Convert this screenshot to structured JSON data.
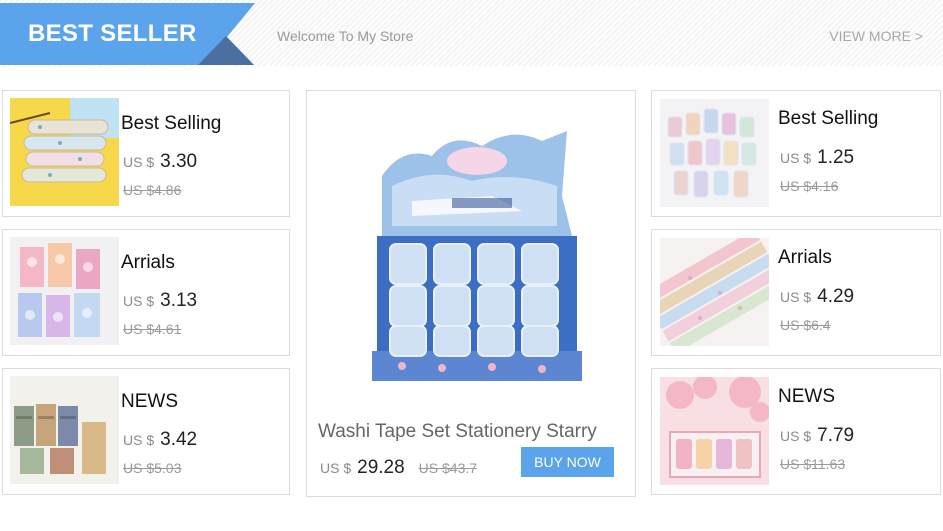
{
  "banner": {
    "title": "BEST SELLER",
    "welcome": "Welcome To My Store",
    "view_more": "VIEW MORE >",
    "accent_color": "#5ba3ea"
  },
  "left_cards": [
    {
      "name": "Best Selling",
      "currency": "US $",
      "price": "3.30",
      "old_price": "US $4.86",
      "image": "washi-tape-rolls-yellow-image"
    },
    {
      "name": "Arrials",
      "currency": "US $",
      "price": "3.13",
      "old_price": "US $4.61",
      "image": "washi-tape-sets-pink-image"
    },
    {
      "name": "NEWS",
      "currency": "US $",
      "price": "3.42",
      "old_price": "US $5.03",
      "image": "washi-tape-stack-image"
    }
  ],
  "right_cards": [
    {
      "name": "Best Selling",
      "currency": "US $",
      "price": "1.25",
      "old_price": "US $4.16",
      "image": "washi-tape-grid-image"
    },
    {
      "name": "Arrials",
      "currency": "US $",
      "price": "4.29",
      "old_price": "US $6.4",
      "image": "washi-tape-pastel-rolls-image"
    },
    {
      "name": "NEWS",
      "currency": "US $",
      "price": "7.79",
      "old_price": "US $11.63",
      "image": "washi-tape-pink-box-image"
    }
  ],
  "feature": {
    "title": "Washi Tape Set Stationery Starry",
    "currency": "US $",
    "price": "29.28",
    "old_price": "US $43.7",
    "button": "BUY NOW",
    "image": "starry-washi-tape-display-box-image"
  }
}
